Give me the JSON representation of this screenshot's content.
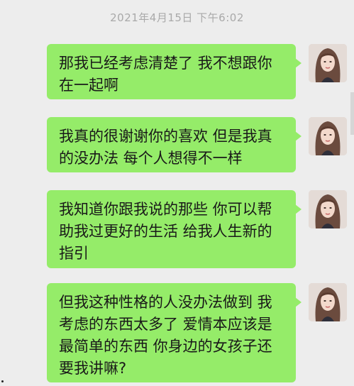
{
  "chat": {
    "timestamp": "2021年4月15日 下午6:02",
    "bubble_color": "#95ec69",
    "background_color": "#ededed",
    "messages": [
      {
        "sender": "self",
        "avatar": "avatar-woman-long-hair",
        "text": "那我已经考虑清楚了 我不想跟你在一起啊"
      },
      {
        "sender": "self",
        "avatar": "avatar-woman-long-hair",
        "text": "我真的很谢谢你的喜欢 但是我真的没办法 每个人想得不一样"
      },
      {
        "sender": "self",
        "avatar": "avatar-woman-long-hair",
        "text": "我知道你跟我说的那些 你可以帮助我过更好的生活 给我人生新的指引"
      },
      {
        "sender": "self",
        "avatar": "avatar-woman-long-hair",
        "text": "但我这种性格的人没办法做到 我考虑的东西太多了 爱情本应该是最简单的东西 你身边的女孩子还要我讲嘛?"
      }
    ]
  }
}
